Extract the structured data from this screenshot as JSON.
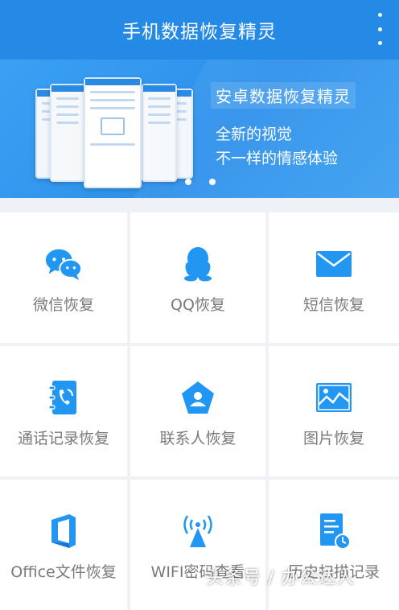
{
  "app": {
    "title": "手机数据恢复精灵",
    "menu_icon": "more-vertical-icon",
    "accent_color": "#2589e6"
  },
  "banner": {
    "headline": "安卓数据恢复精灵",
    "line1": "全新的视觉",
    "line2": "不一样的情感体验",
    "page_count": 2
  },
  "features": [
    {
      "label": "微信恢复",
      "icon": "wechat-icon"
    },
    {
      "label": "QQ恢复",
      "icon": "qq-penguin-icon"
    },
    {
      "label": "短信恢复",
      "icon": "envelope-icon"
    },
    {
      "label": "通话记录恢复",
      "icon": "phone-book-icon"
    },
    {
      "label": "联系人恢复",
      "icon": "contact-pentagon-icon"
    },
    {
      "label": "图片恢复",
      "icon": "picture-icon"
    },
    {
      "label": "Office文件恢复",
      "icon": "office-icon"
    },
    {
      "label": "WIFI密码查看",
      "icon": "wifi-signal-icon"
    },
    {
      "label": "历史扫描记录",
      "icon": "scan-history-icon"
    }
  ],
  "watermark": "头条号 / 办公达人"
}
